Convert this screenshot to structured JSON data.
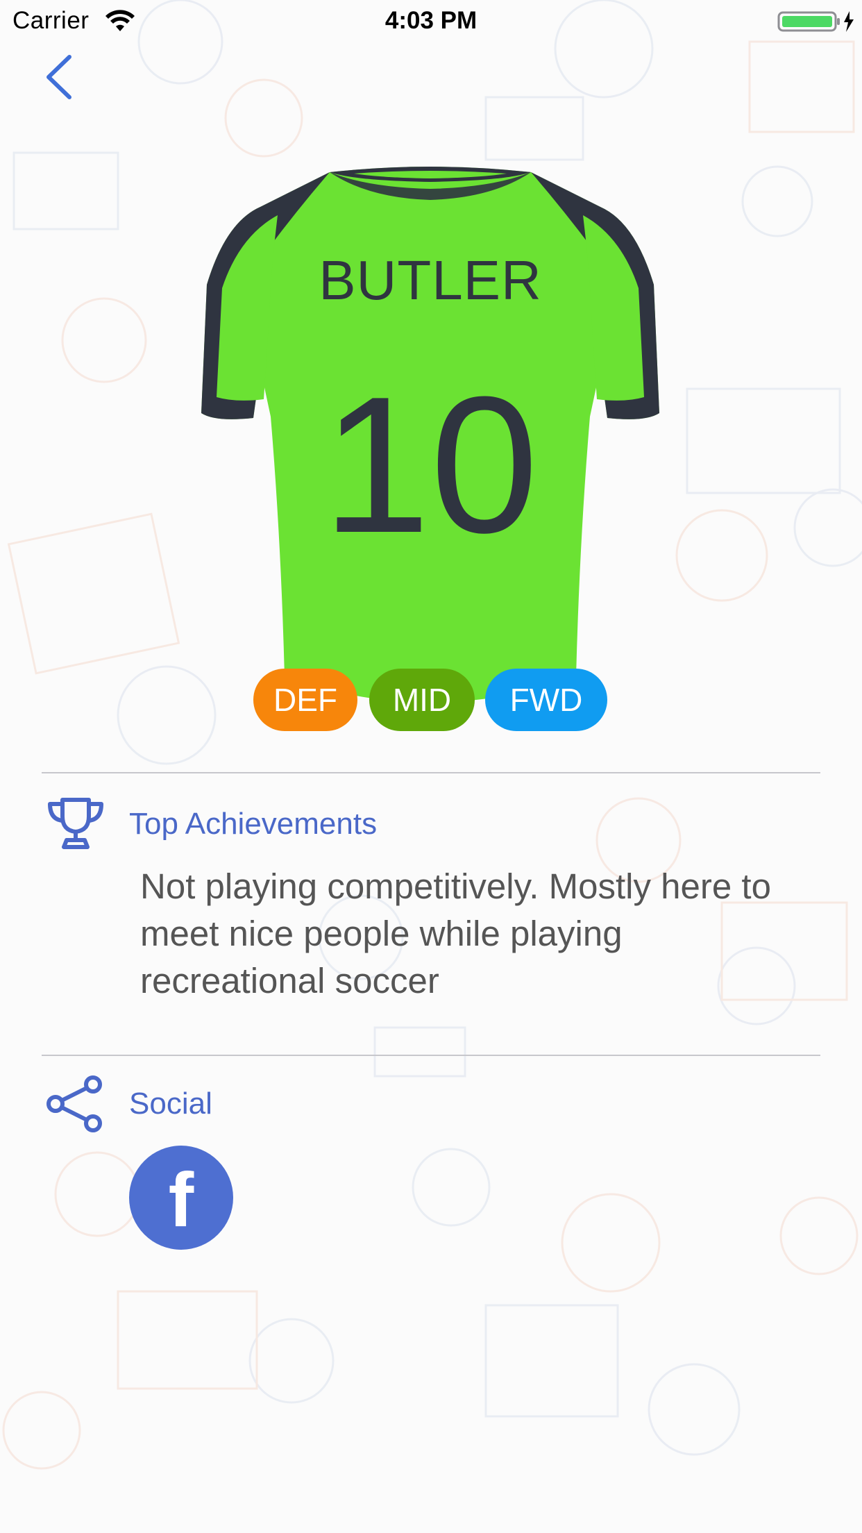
{
  "status_bar": {
    "carrier": "Carrier",
    "time": "4:03 PM",
    "icons": [
      "wifi-icon",
      "battery-icon",
      "charging-bolt-icon"
    ]
  },
  "navigation": {
    "back_icon": "chevron-left-icon"
  },
  "jersey": {
    "name": "BUTLER",
    "number": "10",
    "body_color": "#6be233",
    "trim_color": "#2f3440"
  },
  "positions": [
    {
      "label": "DEF",
      "color": "#f7860b"
    },
    {
      "label": "MID",
      "color": "#5fa80a"
    },
    {
      "label": "FWD",
      "color": "#109cf1"
    }
  ],
  "achievements": {
    "icon": "trophy-icon",
    "title": "Top Achievements",
    "text": "Not playing competitively. Mostly here to meet nice people while playing recreational soccer"
  },
  "social": {
    "icon": "share-icon",
    "title": "Social",
    "facebook_label": "f"
  },
  "colors": {
    "accent": "#4a68c8",
    "facebook": "#4e6fd1",
    "divider": "#c7c7cc"
  }
}
